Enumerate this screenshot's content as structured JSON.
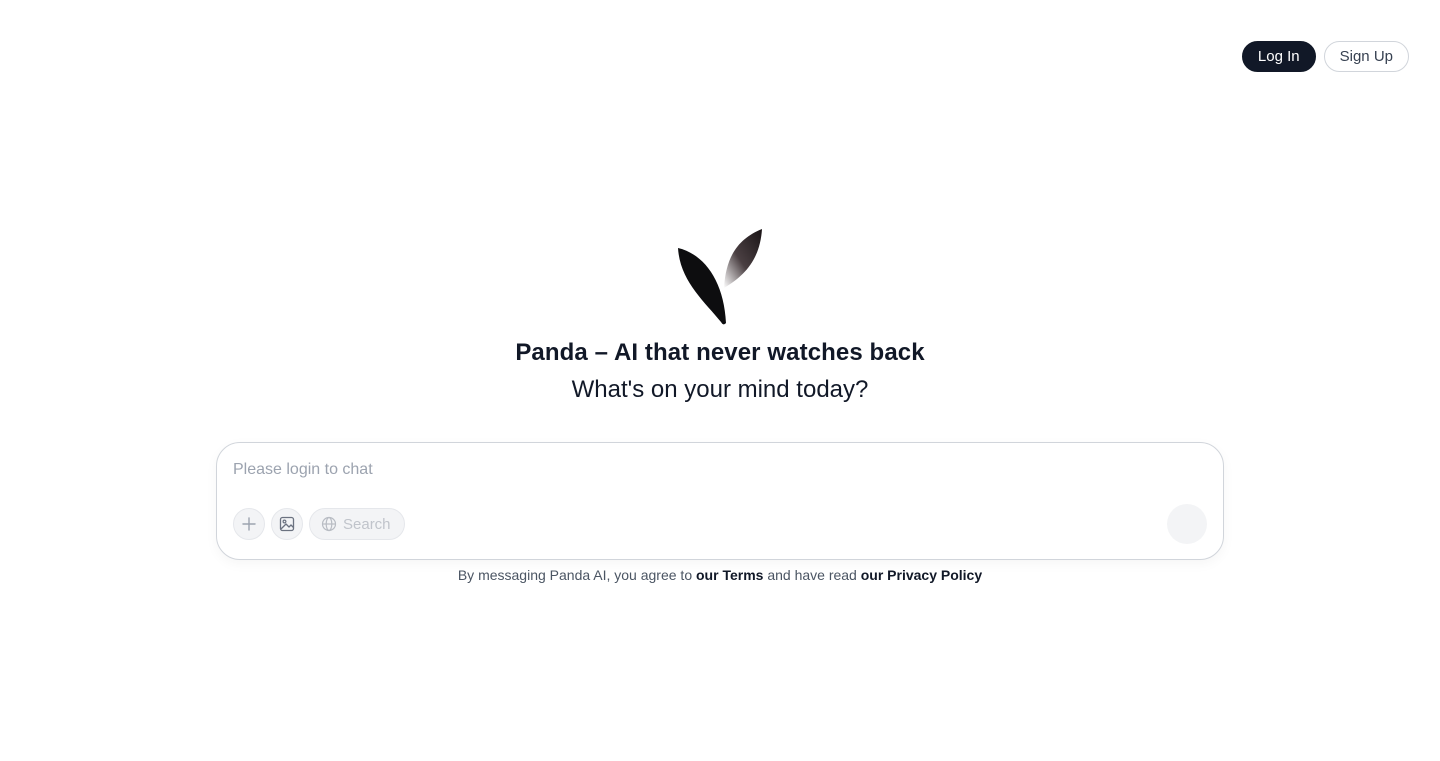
{
  "header": {
    "login_label": "Log In",
    "signup_label": "Sign Up"
  },
  "hero": {
    "title": "Panda – AI that never watches back",
    "subtitle": "What's on your mind today?"
  },
  "composer": {
    "placeholder": "Please login to chat",
    "search_label": "Search"
  },
  "legal": {
    "prefix": "By messaging Panda AI, you agree to ",
    "terms_label": "our Terms",
    "middle": " and have read ",
    "privacy_label": "our Privacy Policy"
  },
  "icons": {
    "logo": "leaf-logo-icon",
    "attach": "plus-icon",
    "image": "image-icon",
    "search": "globe-icon"
  },
  "colors": {
    "primary": "#111827",
    "border": "#d1d5db",
    "muted": "#9ca3af"
  }
}
